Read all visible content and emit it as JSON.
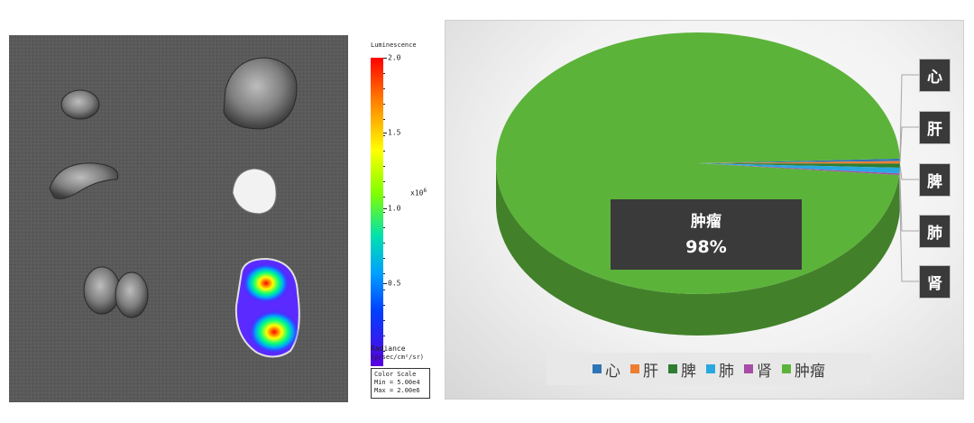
{
  "colorbar": {
    "title": "Luminescence",
    "ticks": [
      "2.0",
      "1.5",
      "1.0",
      "0.5"
    ],
    "multiplier_base": "x10",
    "multiplier_exp": "6",
    "unit_line1": "Radiance",
    "unit_line2": "(p/sec/cm²/sr)",
    "scale_title": "Color Scale",
    "scale_min": "Min = 5.00e4",
    "scale_max": "Max = 2.00e6"
  },
  "chart_data": {
    "type": "pie",
    "categories": [
      "心",
      "肝",
      "脾",
      "肺",
      "肾",
      "肿瘤"
    ],
    "values": [
      0.3,
      0.3,
      0.5,
      0.7,
      0.2,
      98
    ],
    "colors": [
      "#2e75b6",
      "#ed7d31",
      "#2e7d32",
      "#29a8e0",
      "#a64ca6",
      "#5cb33a"
    ],
    "data_labels": {
      "肿瘤": "肿瘤\n98%",
      "callouts": [
        "心",
        "肝",
        "脾",
        "肺",
        "肾"
      ]
    },
    "main_label": {
      "name": "肿瘤",
      "percent": "98%"
    },
    "legend_position": "bottom",
    "style": "3d"
  }
}
